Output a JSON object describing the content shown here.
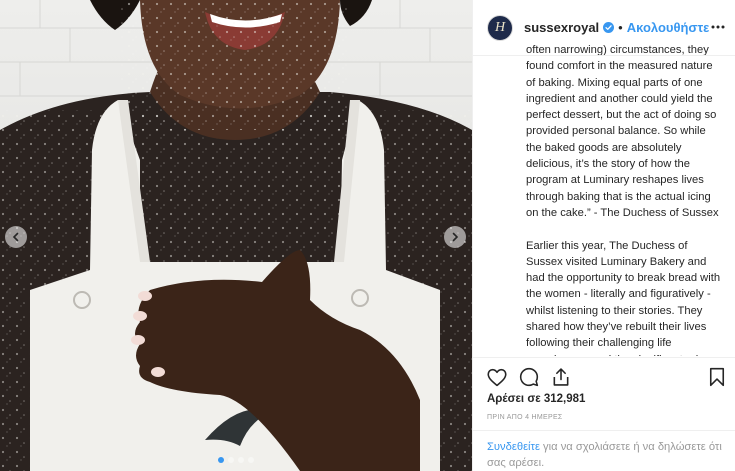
{
  "post": {
    "username": "sussexroyal",
    "follow_label": "Ακολουθήστε",
    "separator": "•",
    "avatar_letter": "H"
  },
  "caption": {
    "paragraphs": [
      "often narrowing) circumstances, they found comfort in the measured nature of baking. Mixing equal parts of one ingredient and another could yield the perfect dessert, but the act of doing so provided personal balance. So while the baked goods are absolutely delicious, it’s the story of how the program at Luminary reshapes lives through baking that is the actual icing on the cake.” - The Duchess of Sussex",
      "Earlier this year, The Duchess of Sussex visited Luminary Bakery and had the opportunity to break bread with the women - literally and figuratively - whilst listening to their stories. They shared how they’ve rebuilt their lives following their challenging life experiences, and the significant role that Luminary Bakery has played in"
    ]
  },
  "stats": {
    "likes_label": "Αρέσει σε 312,981",
    "time_label": "ΠΡΙΝ ΑΠΟ 4 ΗΜΕΡΕΣ"
  },
  "login": {
    "link_label": "Συνδεθείτε",
    "rest_text": " για να σχολιάσετε ή να δηλώσετε ότι σας αρέσει."
  },
  "icons": {
    "like": "heart-icon",
    "comment": "comment-icon",
    "share": "share-icon",
    "save": "bookmark-icon",
    "more": "more-options-icon",
    "verified": "verified-badge-icon"
  },
  "colors": {
    "accent": "#3897f0",
    "text": "#262626",
    "muted": "#999999",
    "border": "#efefef"
  },
  "carousel": {
    "total_slides": 4,
    "active_slide": 1
  }
}
